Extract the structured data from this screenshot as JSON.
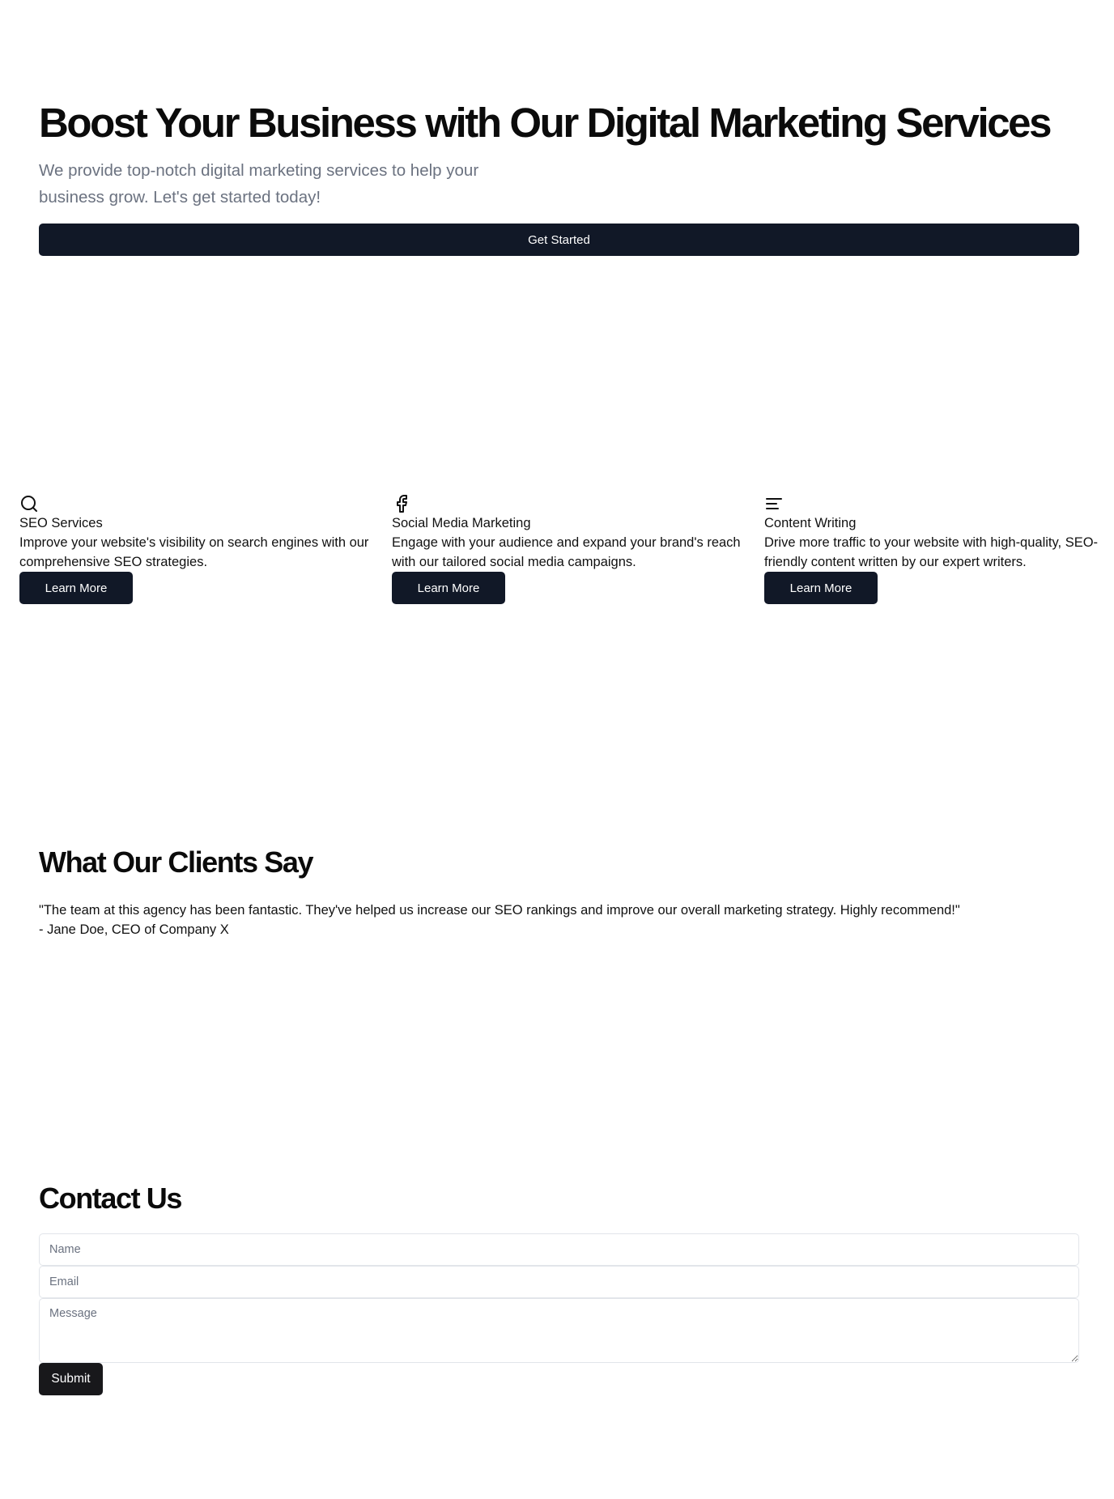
{
  "hero": {
    "title": "Boost Your Business with Our Digital Marketing Services",
    "subtitle": "We provide top-notch digital marketing services to help your business grow. Let's get started today!",
    "cta_label": "Get Started"
  },
  "services": [
    {
      "icon": "search-icon",
      "title": "SEO Services",
      "description": "Improve your website's visibility on search engines with our comprehensive SEO strategies.",
      "button_label": "Learn More"
    },
    {
      "icon": "facebook-icon",
      "title": "Social Media Marketing",
      "description": "Engage with your audience and expand your brand's reach with our tailored social media campaigns.",
      "button_label": "Learn More"
    },
    {
      "icon": "text-align-left-icon",
      "title": "Content Writing",
      "description": "Drive more traffic to your website with high-quality, SEO-friendly content written by our expert writers.",
      "button_label": "Learn More"
    }
  ],
  "testimonials": {
    "heading": "What Our Clients Say",
    "quote": "\"The team at this agency has been fantastic. They've helped us increase our SEO rankings and improve our overall marketing strategy. Highly recommend!\"",
    "author": "- Jane Doe, CEO of Company X"
  },
  "contact": {
    "heading": "Contact Us",
    "name_placeholder": "Name",
    "email_placeholder": "Email",
    "message_placeholder": "Message",
    "submit_label": "Submit"
  },
  "colors": {
    "button_bg": "#111827",
    "submit_bg": "#18181b",
    "muted_text": "#6b7280"
  }
}
